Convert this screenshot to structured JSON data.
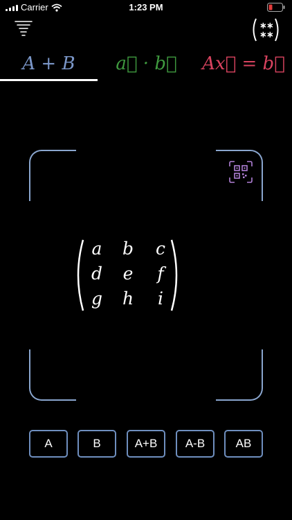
{
  "status_bar": {
    "carrier": "Carrier",
    "time": "1:23 PM"
  },
  "top_bar": {
    "left_icon": "tornado-icon",
    "right_icon": "matrix-keypad-icon",
    "right_icon_glyph": "∗∗\n∗∗"
  },
  "tabs": [
    {
      "label": "A + B",
      "color": "#7b97c9",
      "active": true
    },
    {
      "label": "a⃗ · b⃗",
      "color": "#3f9a3f",
      "active": false
    },
    {
      "label": "Ax⃗ = b⃗",
      "color": "#d9435f",
      "active": false
    }
  ],
  "scanner": {
    "qr_icon": "qr-code-scan-icon",
    "frame_color": "#8aa6cf",
    "qr_color": "#b07fd6"
  },
  "matrix": {
    "cells": [
      [
        "a",
        "b",
        "c"
      ],
      [
        "d",
        "e",
        "f"
      ],
      [
        "g",
        "h",
        "i"
      ]
    ]
  },
  "buttons": [
    {
      "label": "A"
    },
    {
      "label": "B"
    },
    {
      "label": "A+B"
    },
    {
      "label": "A-B"
    },
    {
      "label": "AB"
    }
  ]
}
